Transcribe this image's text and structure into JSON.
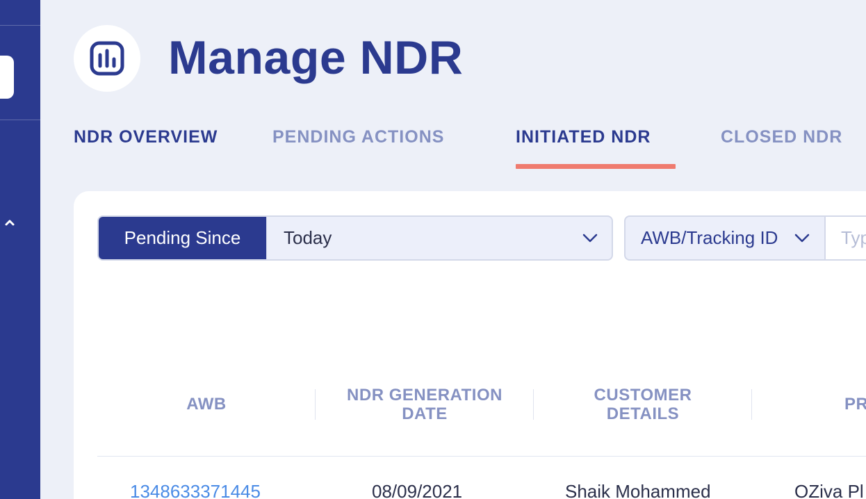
{
  "sidebar": {
    "collapse_icon": "chevron-up-icon"
  },
  "header": {
    "logo_icon": "bar-chart-icon",
    "title": "Manage NDR"
  },
  "tabs": [
    {
      "label": "NDR OVERVIEW",
      "active": false
    },
    {
      "label": "PENDING ACTIONS",
      "active": false
    },
    {
      "label": "INITIATED NDR",
      "active": true
    },
    {
      "label": "CLOSED NDR",
      "active": false
    }
  ],
  "filters": {
    "pending_since_label": "Pending Since",
    "date_value": "Today",
    "search_type": "AWB/Tracking ID",
    "search_placeholder": "Type"
  },
  "table": {
    "columns": [
      "AWB",
      "NDR GENERATION\nDATE",
      "CUSTOMER\nDETAILS",
      "PR"
    ],
    "rows": [
      {
        "awb": "1348633371445",
        "date": "08/09/2021",
        "customer": "Shaik Mohammed",
        "product": "OZiva Pl"
      }
    ]
  },
  "colors": {
    "primary": "#2b3a8f",
    "muted": "#8591c2",
    "accent": "#ef7b6f",
    "link": "#4a8be6",
    "background": "#edf0f8"
  }
}
